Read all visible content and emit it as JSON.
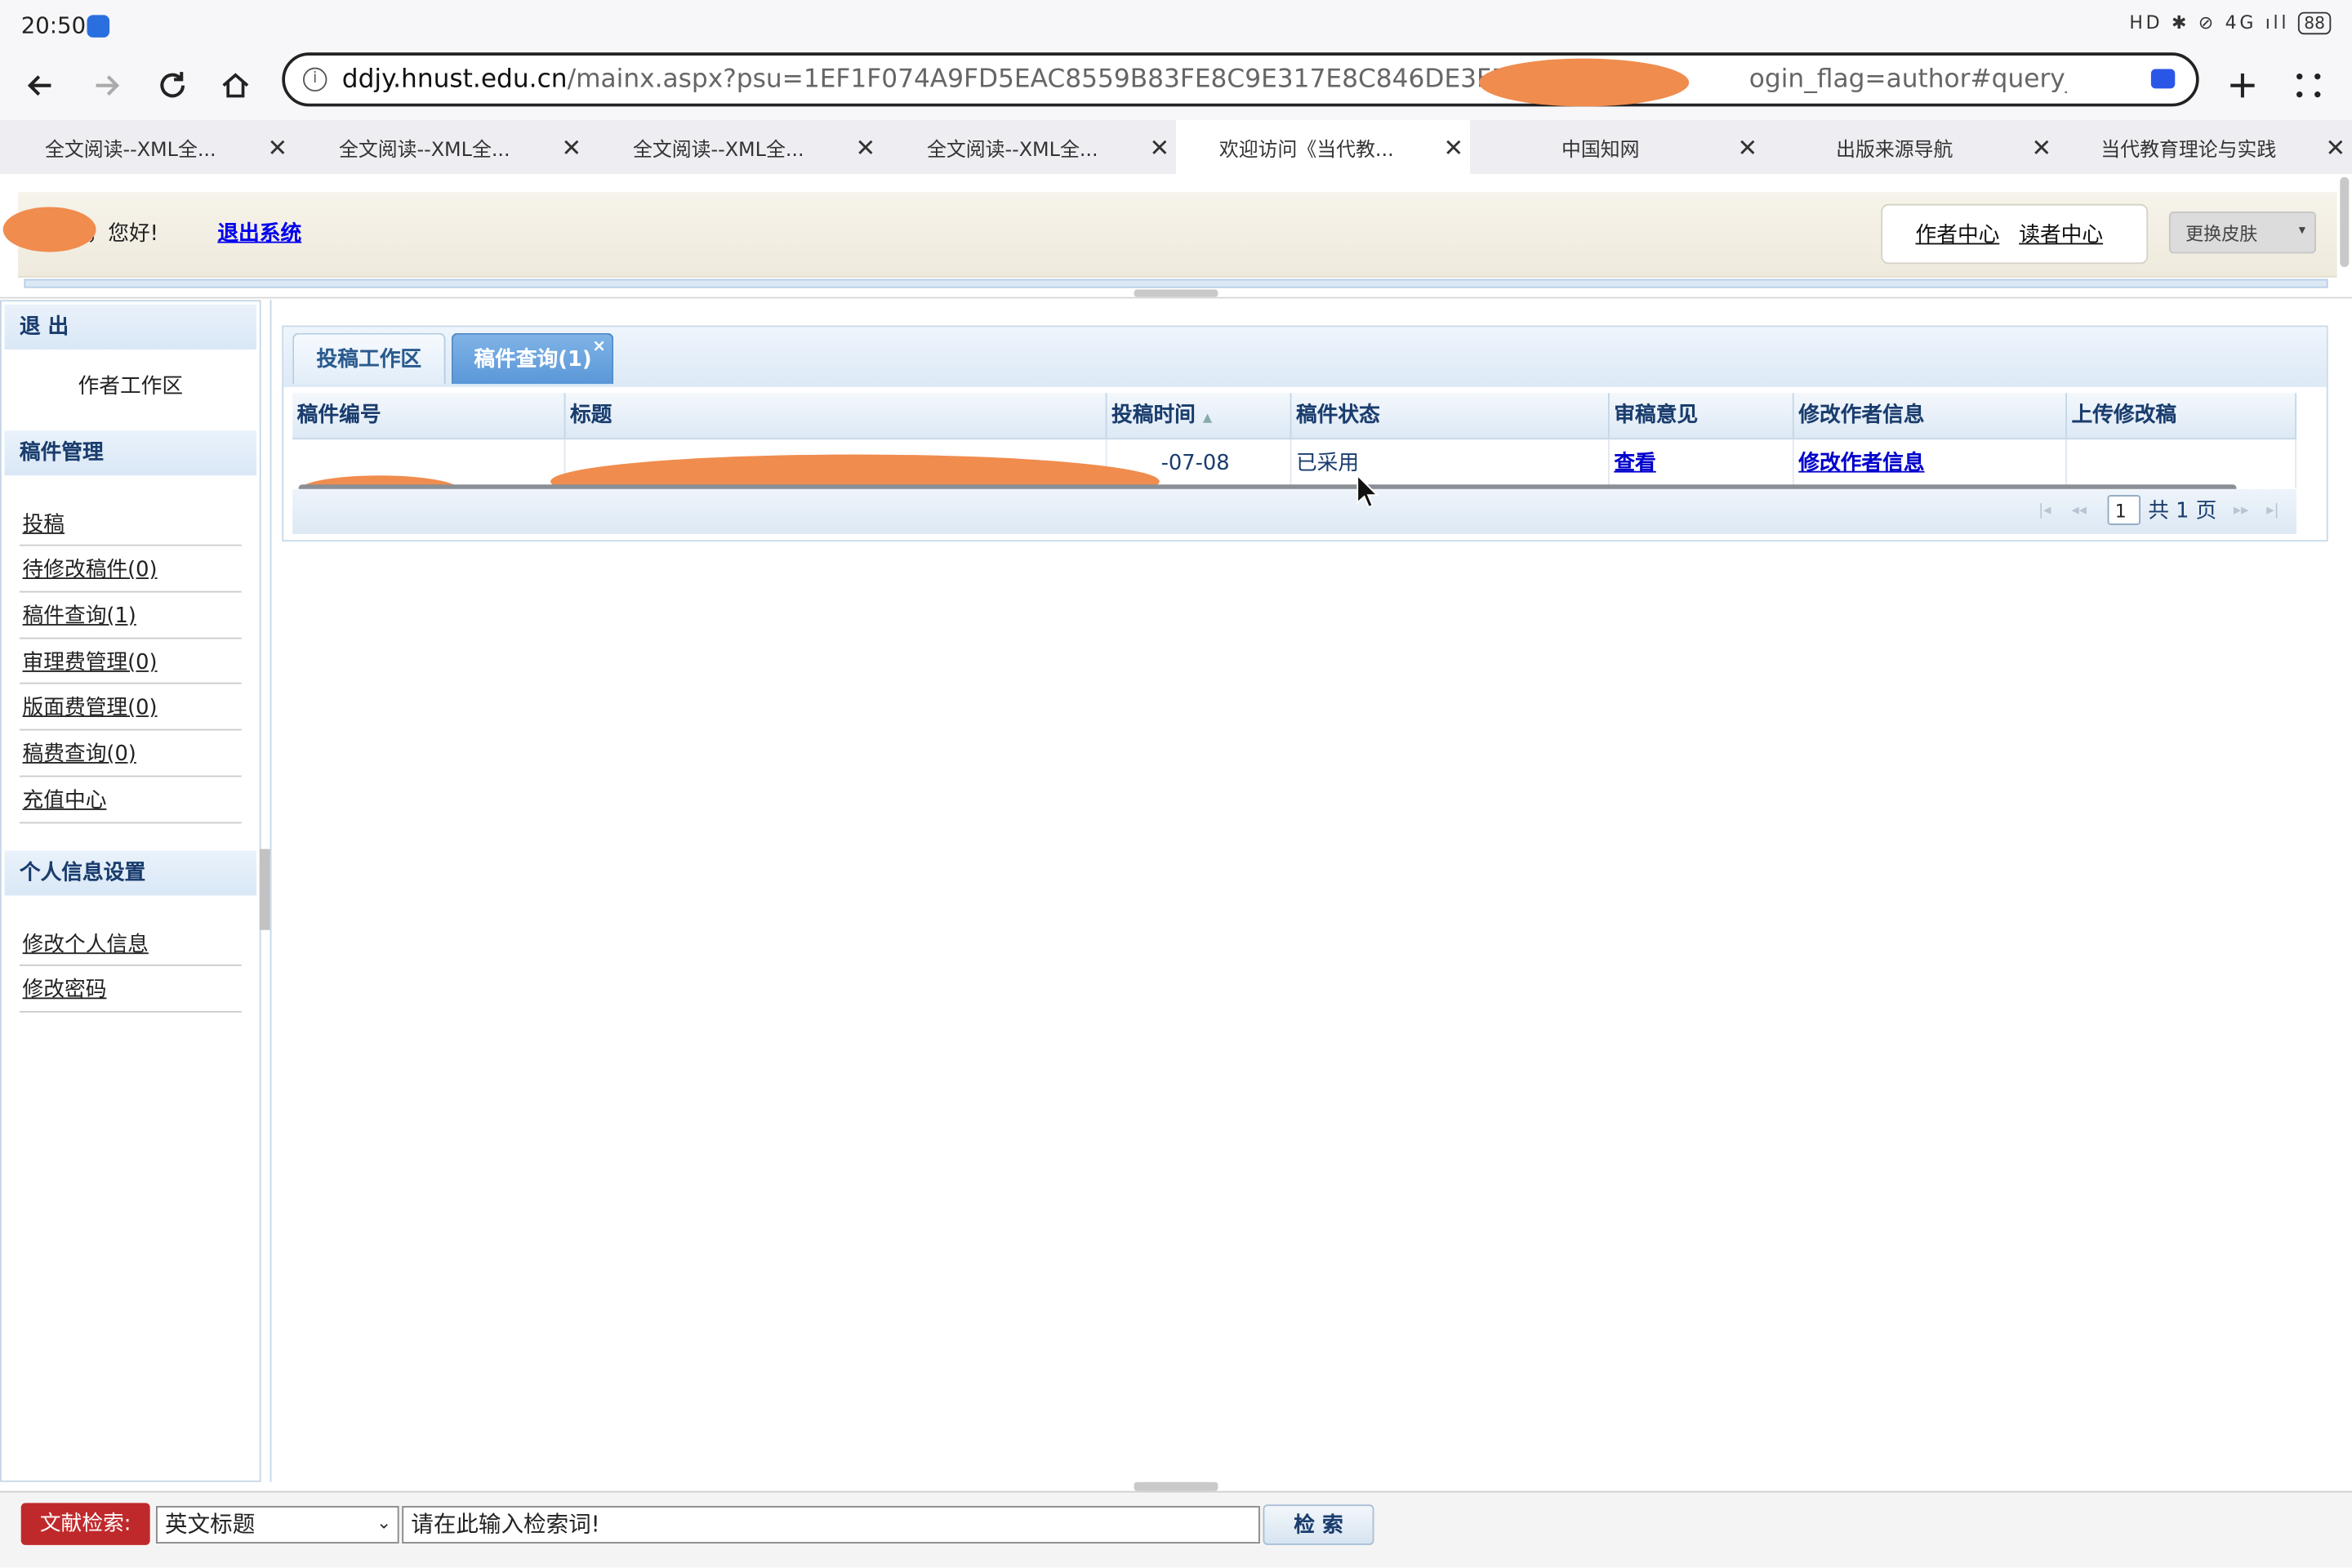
{
  "status_bar": {
    "time": "20:50",
    "icons": "HD ✱ ⊘ 4G ıll",
    "battery": "88"
  },
  "browser": {
    "url_domain": "ddjy.hnust.edu.cn",
    "url_path_start": "/mainx.aspx?psu=1EF1F074A9FD5EAC8559B83FE8C9E317E8C846DE3F5AAC3",
    "url_path_end": "ogin_flag=author#query_article_list_ui",
    "tabs": [
      {
        "label": "全文阅读--XML全..."
      },
      {
        "label": "全文阅读--XML全..."
      },
      {
        "label": "全文阅读--XML全..."
      },
      {
        "label": "全文阅读--XML全..."
      },
      {
        "label": "欢迎访问《当代教..."
      },
      {
        "label": "中国知网"
      },
      {
        "label": "出版来源导航"
      },
      {
        "label": "当代教育理论与实践"
      }
    ],
    "close_glyph": "✕"
  },
  "header": {
    "greeting": "者，您好!",
    "logout": "退出系统",
    "author_center": "作者中心",
    "reader_center": "读者中心",
    "skin": "更换皮肤"
  },
  "sidebar": {
    "exit_title": "退 出",
    "workspace": "作者工作区",
    "manuscript_title": "稿件管理",
    "manuscript_items": [
      "投稿",
      "待修改稿件(0)",
      "稿件查询(1)",
      "审理费管理(0)",
      "版面费管理(0)",
      "稿费查询(0)",
      "充值中心"
    ],
    "personal_title": "个人信息设置",
    "personal_items": [
      "修改个人信息",
      "修改密码"
    ]
  },
  "panel": {
    "tab_workspace": "投稿工作区",
    "tab_query": "稿件查询(1)",
    "tab_close": "×"
  },
  "grid": {
    "columns": [
      "稿件编号",
      "标题",
      "投稿时间",
      "稿件状态",
      "审稿意见",
      "修改作者信息",
      "上传修改稿"
    ],
    "sort_glyph": "▲",
    "row": {
      "date": "-07-08",
      "status": "已采用",
      "review": "查看",
      "edit_author": "修改作者信息",
      "upload": ""
    },
    "pager": {
      "current_page": "1",
      "total": "共 1 页"
    }
  },
  "search": {
    "label": "文献检索:",
    "field": "英文标题",
    "placeholder": "请在此输入检索词!",
    "button": "检 索"
  },
  "colors": {
    "redaction": "#f08c4e",
    "accent_blue": "#5a97d8",
    "search_label": "#c0292b"
  }
}
